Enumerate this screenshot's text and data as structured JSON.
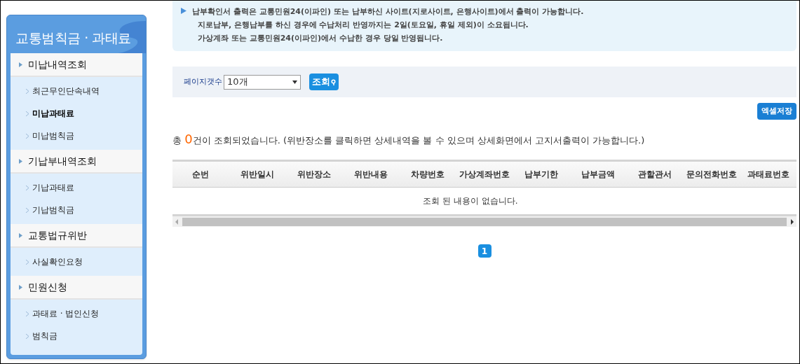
{
  "sidebar": {
    "title": "교통범칙금 · 과태료",
    "groups": [
      {
        "label": "미납내역조회",
        "children": [
          {
            "label": "최근무인단속내역",
            "selected": false
          },
          {
            "label": "미납과태료",
            "selected": true
          },
          {
            "label": "미납범칙금",
            "selected": false
          }
        ]
      },
      {
        "label": "기납부내역조회",
        "children": [
          {
            "label": "기납과태료",
            "selected": false
          },
          {
            "label": "기납범칙금",
            "selected": false
          }
        ]
      },
      {
        "label": "교통법규위반",
        "children": [
          {
            "label": "사실확인요청",
            "selected": false
          }
        ]
      },
      {
        "label": "민원신청",
        "children": [
          {
            "label": "과태료 · 법인신청",
            "selected": false
          },
          {
            "label": "범칙금",
            "selected": false
          }
        ]
      }
    ]
  },
  "notice": [
    "납부확인서 출력은 교통민원24(이파인) 또는 납부하신 사이트(지로사이트, 은행사이트)에서 출력이 가능합니다.",
    "지로납부, 은행납부를 하신 경우에 수납처리 반영까지는 2일(토요일, 휴일 제외)이 소요됩니다.",
    "가상계좌 또는 교통민원24(이파인)에서 수납한 경우 당일 반영됩니다."
  ],
  "search": {
    "label": "페이지갯수",
    "page_size": "10개",
    "button": "조회"
  },
  "excel_button": "엑셀저장",
  "result": {
    "prefix": "총 ",
    "count": "0",
    "suffix": "건이 조회되었습니다. (위반장소를 클릭하면 상세내역을 볼 수 있으며 상세화면에서 고지서출력이 가능합니다.)"
  },
  "table": {
    "columns": [
      "순번",
      "위반일시",
      "위반장소",
      "위반내용",
      "차량번호",
      "가상계좌번호",
      "납부기한",
      "납부금액",
      "관할관서",
      "문의전화번호",
      "과태료번호"
    ],
    "empty": "조회 된 내용이 없습니다."
  },
  "pagination": [
    {
      "label": "1",
      "selected": true
    }
  ]
}
